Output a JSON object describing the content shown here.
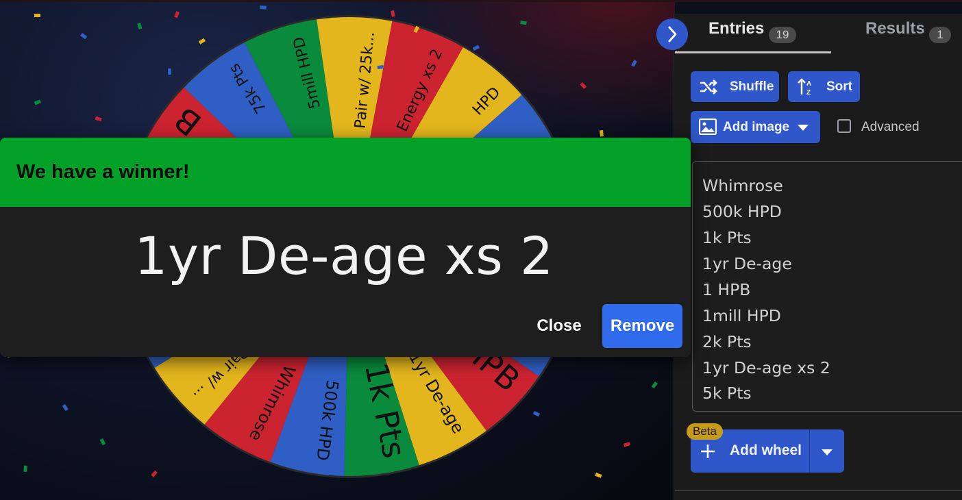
{
  "theme": {
    "accent": "#2f57c9",
    "winner_header": "#04a129",
    "remove_button": "#2f6bea",
    "panel_bg": "#1b1b1b",
    "slice_colors": [
      "#cc2331",
      "#2f5fc4",
      "#0a8a3c",
      "#e3b61d"
    ]
  },
  "wheel": {
    "upper_labels": [
      {
        "text": "B",
        "color": "yellow"
      },
      {
        "text": "75k Pts",
        "color": "red"
      },
      {
        "text": "5mill HPD",
        "color": "blue"
      },
      {
        "text": "Pair w/ 25k...",
        "color": "green"
      },
      {
        "text": "Energy xs 2",
        "color": "yellow"
      },
      {
        "text": "HPD",
        "color": "red"
      }
    ],
    "lower_labels": [
      {
        "text": "Pair w/ ...",
        "color": "yellow"
      },
      {
        "text": "Whimrose",
        "color": "blue"
      },
      {
        "text": "500k HPD",
        "color": "red"
      },
      {
        "text": "1k Pts",
        "color": "yellow"
      },
      {
        "text": "1yr De-age",
        "color": "green"
      },
      {
        "text": "1 HPB",
        "color": "blue"
      },
      {
        "text": "1mill HPD",
        "color": "red"
      }
    ]
  },
  "dialog": {
    "title": "We have a winner!",
    "winner": "1yr De-age xs 2",
    "close_label": "Close",
    "remove_label": "Remove"
  },
  "panel": {
    "tabs": [
      {
        "label": "Entries",
        "count": "19"
      },
      {
        "label": "Results",
        "count": "1"
      }
    ],
    "toggle_icon": "chevron-right-icon",
    "shuffle_label": "Shuffle",
    "shuffle_icon": "shuffle-icon",
    "sort_label": "Sort",
    "sort_icon": "sort-icon",
    "add_image_label": "Add image",
    "add_image_icon": "image-icon",
    "advanced_label": "Advanced",
    "advanced_checked": false,
    "entries": [
      "Whimrose",
      "500k HPD",
      "1k Pts",
      "1yr De-age",
      "1 HPB",
      "1mill HPD",
      "2k Pts",
      "1yr De-age xs 2",
      "5k Pts"
    ],
    "beta_badge": "Beta",
    "add_wheel_label": "Add wheel",
    "add_wheel_icon": "plus-icon"
  }
}
